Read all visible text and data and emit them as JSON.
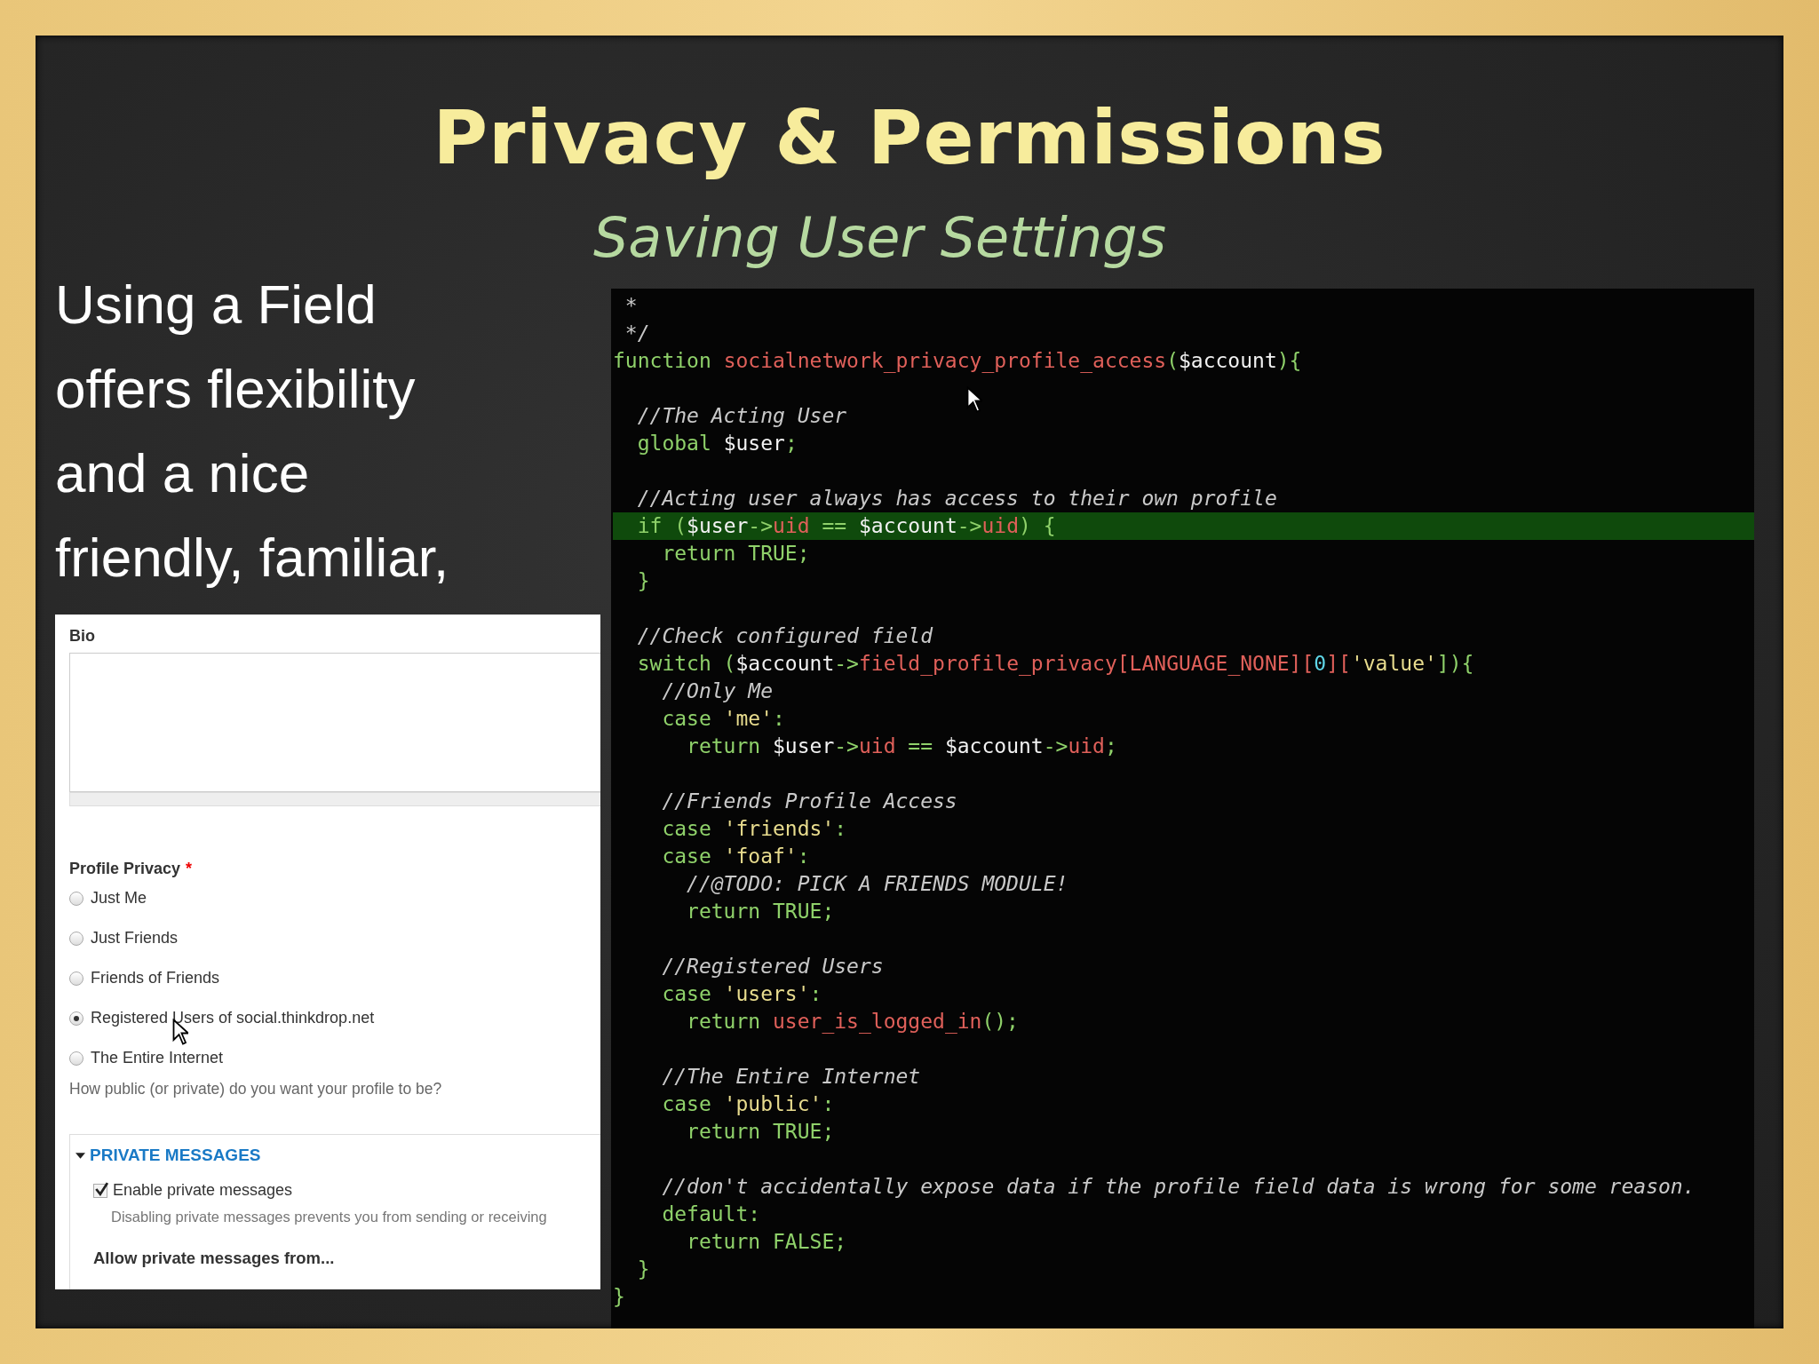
{
  "slide": {
    "title": "Privacy & Permissions",
    "subtitle": "Saving User Settings",
    "body_lines": [
      "Using a Field",
      "offers flexibility",
      "and a nice",
      "friendly, familiar,"
    ]
  },
  "form": {
    "bio": {
      "label": "Bio"
    },
    "privacy": {
      "label": "Profile Privacy",
      "required_mark": "*",
      "options": [
        {
          "label": "Just Me",
          "selected": false
        },
        {
          "label": "Just Friends",
          "selected": false
        },
        {
          "label": "Friends of Friends",
          "selected": false
        },
        {
          "label": "Registered Users of social.thinkdrop.net",
          "selected": true
        },
        {
          "label": "The Entire Internet",
          "selected": false
        }
      ],
      "description": "How public (or private) do you want your profile to be?"
    },
    "private_messages": {
      "legend": "PRIVATE MESSAGES",
      "expanded": true,
      "enable": {
        "label": "Enable private messages",
        "checked": true,
        "description": "Disabling private messages prevents you from sending or receiving"
      },
      "allow_label": "Allow private messages from..."
    }
  },
  "code": {
    "lines": [
      {
        "kind": "code",
        "highlighted": false,
        "tokens": [
          {
            "t": " *",
            "kind": "comment"
          }
        ]
      },
      {
        "kind": "code",
        "highlighted": false,
        "tokens": [
          {
            "t": " */",
            "kind": "comment"
          }
        ]
      },
      {
        "kind": "code",
        "highlighted": false,
        "tokens": [
          {
            "t": "function ",
            "kind": "keyword"
          },
          {
            "t": "socialnetwork_privacy_profile_access",
            "kind": "name"
          },
          {
            "t": "(",
            "kind": "keyword"
          },
          {
            "t": "$account",
            "kind": "var"
          },
          {
            "t": "){",
            "kind": "keyword"
          }
        ]
      },
      {
        "kind": "blank"
      },
      {
        "kind": "code",
        "highlighted": false,
        "tokens": [
          {
            "t": "  //The Acting User",
            "kind": "comment"
          }
        ]
      },
      {
        "kind": "code",
        "highlighted": false,
        "tokens": [
          {
            "t": "  global ",
            "kind": "keyword"
          },
          {
            "t": "$user",
            "kind": "var"
          },
          {
            "t": ";",
            "kind": "keyword"
          }
        ]
      },
      {
        "kind": "blank"
      },
      {
        "kind": "code",
        "highlighted": false,
        "tokens": [
          {
            "t": "  //Acting user always has access to their own profile",
            "kind": "comment"
          }
        ]
      },
      {
        "kind": "code",
        "highlighted": true,
        "tokens": [
          {
            "t": "  if (",
            "kind": "keyword"
          },
          {
            "t": "$user",
            "kind": "var"
          },
          {
            "t": "->",
            "kind": "keyword"
          },
          {
            "t": "uid",
            "kind": "name"
          },
          {
            "t": " == ",
            "kind": "keyword"
          },
          {
            "t": "$account",
            "kind": "var"
          },
          {
            "t": "->",
            "kind": "keyword"
          },
          {
            "t": "uid",
            "kind": "name"
          },
          {
            "t": ") {",
            "kind": "keyword"
          }
        ]
      },
      {
        "kind": "code",
        "highlighted": false,
        "tokens": [
          {
            "t": "    return TRUE;",
            "kind": "keyword"
          }
        ]
      },
      {
        "kind": "code",
        "highlighted": false,
        "tokens": [
          {
            "t": "  }",
            "kind": "keyword"
          }
        ]
      },
      {
        "kind": "blank"
      },
      {
        "kind": "code",
        "highlighted": false,
        "tokens": [
          {
            "t": "  //Check configured field",
            "kind": "comment"
          }
        ]
      },
      {
        "kind": "code",
        "highlighted": false,
        "tokens": [
          {
            "t": "  switch (",
            "kind": "keyword"
          },
          {
            "t": "$account",
            "kind": "var"
          },
          {
            "t": "->",
            "kind": "keyword"
          },
          {
            "t": "field_profile_privacy[LANGUAGE_NONE][",
            "kind": "name"
          },
          {
            "t": "0",
            "kind": "number"
          },
          {
            "t": "][",
            "kind": "name"
          },
          {
            "t": "'value'",
            "kind": "string"
          },
          {
            "t": "]){",
            "kind": "keyword"
          }
        ]
      },
      {
        "kind": "code",
        "highlighted": false,
        "tokens": [
          {
            "t": "    //Only Me",
            "kind": "comment"
          }
        ]
      },
      {
        "kind": "code",
        "highlighted": false,
        "tokens": [
          {
            "t": "    case ",
            "kind": "keyword"
          },
          {
            "t": "'me'",
            "kind": "string"
          },
          {
            "t": ":",
            "kind": "keyword"
          }
        ]
      },
      {
        "kind": "code",
        "highlighted": false,
        "tokens": [
          {
            "t": "      return ",
            "kind": "keyword"
          },
          {
            "t": "$user",
            "kind": "var"
          },
          {
            "t": "->",
            "kind": "keyword"
          },
          {
            "t": "uid",
            "kind": "name"
          },
          {
            "t": " == ",
            "kind": "keyword"
          },
          {
            "t": "$account",
            "kind": "var"
          },
          {
            "t": "->",
            "kind": "keyword"
          },
          {
            "t": "uid",
            "kind": "name"
          },
          {
            "t": ";",
            "kind": "keyword"
          }
        ]
      },
      {
        "kind": "blank"
      },
      {
        "kind": "code",
        "highlighted": false,
        "tokens": [
          {
            "t": "    //Friends Profile Access",
            "kind": "comment"
          }
        ]
      },
      {
        "kind": "code",
        "highlighted": false,
        "tokens": [
          {
            "t": "    case ",
            "kind": "keyword"
          },
          {
            "t": "'friends'",
            "kind": "string"
          },
          {
            "t": ":",
            "kind": "keyword"
          }
        ]
      },
      {
        "kind": "code",
        "highlighted": false,
        "tokens": [
          {
            "t": "    case ",
            "kind": "keyword"
          },
          {
            "t": "'foaf'",
            "kind": "string"
          },
          {
            "t": ":",
            "kind": "keyword"
          }
        ]
      },
      {
        "kind": "code",
        "highlighted": false,
        "tokens": [
          {
            "t": "      //@TODO: PICK A FRIENDS MODULE!",
            "kind": "comment"
          }
        ]
      },
      {
        "kind": "code",
        "highlighted": false,
        "tokens": [
          {
            "t": "      return TRUE;",
            "kind": "keyword"
          }
        ]
      },
      {
        "kind": "blank"
      },
      {
        "kind": "code",
        "highlighted": false,
        "tokens": [
          {
            "t": "    //Registered Users",
            "kind": "comment"
          }
        ]
      },
      {
        "kind": "code",
        "highlighted": false,
        "tokens": [
          {
            "t": "    case ",
            "kind": "keyword"
          },
          {
            "t": "'users'",
            "kind": "string"
          },
          {
            "t": ":",
            "kind": "keyword"
          }
        ]
      },
      {
        "kind": "code",
        "highlighted": false,
        "tokens": [
          {
            "t": "      return ",
            "kind": "keyword"
          },
          {
            "t": "user_is_logged_in",
            "kind": "name"
          },
          {
            "t": "();",
            "kind": "keyword"
          }
        ]
      },
      {
        "kind": "blank"
      },
      {
        "kind": "code",
        "highlighted": false,
        "tokens": [
          {
            "t": "    //The Entire Internet",
            "kind": "comment"
          }
        ]
      },
      {
        "kind": "code",
        "highlighted": false,
        "tokens": [
          {
            "t": "    case ",
            "kind": "keyword"
          },
          {
            "t": "'public'",
            "kind": "string"
          },
          {
            "t": ":",
            "kind": "keyword"
          }
        ]
      },
      {
        "kind": "code",
        "highlighted": false,
        "tokens": [
          {
            "t": "      return TRUE;",
            "kind": "keyword"
          }
        ]
      },
      {
        "kind": "blank"
      },
      {
        "kind": "code",
        "highlighted": false,
        "tokens": [
          {
            "t": "    //don't accidentally expose data if the profile field data is wrong for some reason.",
            "kind": "comment"
          }
        ]
      },
      {
        "kind": "code",
        "highlighted": false,
        "tokens": [
          {
            "t": "    default:",
            "kind": "keyword"
          }
        ]
      },
      {
        "kind": "code",
        "highlighted": false,
        "tokens": [
          {
            "t": "      return FALSE;",
            "kind": "keyword"
          }
        ]
      },
      {
        "kind": "code",
        "highlighted": false,
        "tokens": [
          {
            "t": "  }",
            "kind": "keyword"
          }
        ]
      },
      {
        "kind": "code",
        "highlighted": false,
        "tokens": [
          {
            "t": "}",
            "kind": "keyword"
          }
        ]
      }
    ]
  }
}
